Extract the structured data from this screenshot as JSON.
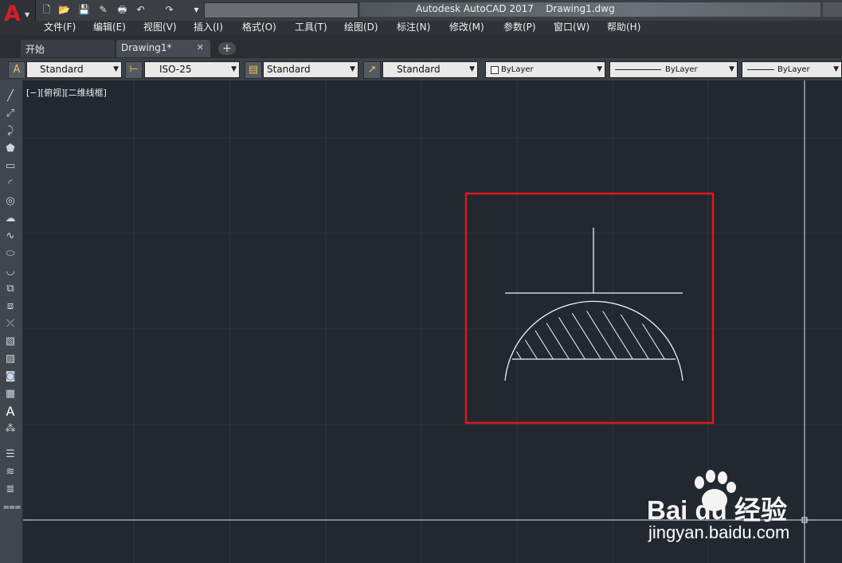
{
  "window": {
    "title": "Autodesk AutoCAD 2017",
    "document": "Drawing1.dwg"
  },
  "app_button": {
    "icon": "autocad-logo-icon",
    "letter": "A",
    "arrow": "▼"
  },
  "quick_access": [
    {
      "name": "new-file-icon",
      "glyph": "🗋"
    },
    {
      "name": "open-file-icon",
      "glyph": "📂"
    },
    {
      "name": "save-icon",
      "glyph": "💾"
    },
    {
      "name": "save-as-icon",
      "glyph": "✎"
    },
    {
      "name": "print-icon",
      "glyph": "🖶"
    },
    {
      "name": "undo-icon",
      "glyph": "↶"
    },
    {
      "name": "redo-icon",
      "glyph": "↷"
    },
    {
      "name": "customize-icon",
      "glyph": "▾"
    }
  ],
  "menubar": [
    "文件(F)",
    "编辑(E)",
    "视图(V)",
    "插入(I)",
    "格式(O)",
    "工具(T)",
    "绘图(D)",
    "标注(N)",
    "修改(M)",
    "参数(P)",
    "窗口(W)",
    "帮助(H)"
  ],
  "tabs": {
    "start": "开始",
    "drawing": "Drawing1*",
    "close_glyph": "✕",
    "add_glyph": "+"
  },
  "style_toolbar": {
    "text_style": "Standard",
    "dim_style": "ISO-25",
    "table_style": "Standard",
    "multileader_style": "Standard",
    "color": "ByLayer",
    "linetype": "ByLayer",
    "lineweight": "ByLayer"
  },
  "viewport_label": "[−][俯视][二维线框]",
  "watermark": {
    "brand": "Bai du 经验",
    "url": "jingyan.baidu.com"
  },
  "colors": {
    "canvas": "#212830",
    "highlight_box": "#e0161b",
    "drawing_lines": "#f2f2f2"
  }
}
